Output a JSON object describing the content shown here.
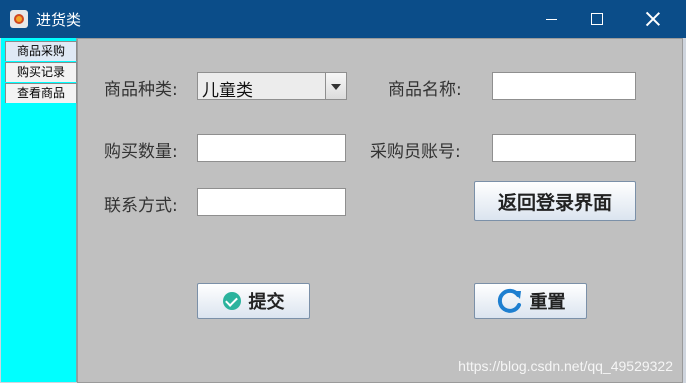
{
  "window": {
    "title": "进货类",
    "icons": {
      "app": "java-coffee-icon",
      "minimize": "minimize-icon",
      "maximize": "maximize-icon",
      "close": "close-icon"
    }
  },
  "tabs": [
    {
      "label": "商品采购",
      "active": true
    },
    {
      "label": "购买记录",
      "active": false
    },
    {
      "label": "查看商品",
      "active": false
    }
  ],
  "form": {
    "category": {
      "label": "商品种类:",
      "value": "儿童类"
    },
    "product_name": {
      "label": "商品名称:",
      "value": ""
    },
    "quantity": {
      "label": "购买数量:",
      "value": ""
    },
    "buyer_account": {
      "label": "采购员账号:",
      "value": ""
    },
    "contact": {
      "label": "联系方式:",
      "value": ""
    }
  },
  "buttons": {
    "return_login": "返回登录界面",
    "submit": "提交",
    "reset": "重置"
  },
  "icons": {
    "submit": "check-circle-icon",
    "reset": "refresh-icon"
  },
  "colors": {
    "tab_strip": "#00ffff",
    "title_bar": "#0b4d89",
    "panel": "#c0c0c0",
    "submit_icon": "#2bb39d",
    "reset_icon": "#1e7fd0"
  },
  "watermark": "https://blog.csdn.net/qq_49529322"
}
